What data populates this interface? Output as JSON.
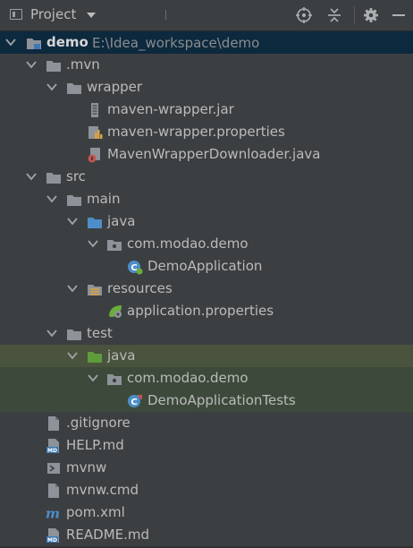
{
  "header": {
    "title": "Project"
  },
  "tree": {
    "root": {
      "name": "demo",
      "path": "E:\\Idea_workspace\\demo"
    },
    "mvn": ".mvn",
    "wrapper": "wrapper",
    "wrapper_jar": "maven-wrapper.jar",
    "wrapper_props": "maven-wrapper.properties",
    "wrapper_downloader": "MavenWrapperDownloader.java",
    "src": "src",
    "main": "main",
    "main_java": "java",
    "main_pkg": "com.modao.demo",
    "main_class": "DemoApplication",
    "resources": "resources",
    "app_props": "application.properties",
    "test": "test",
    "test_java": "java",
    "test_pkg": "com.modao.demo",
    "test_class": "DemoApplicationTests",
    "gitignore": ".gitignore",
    "help": "HELP.md",
    "mvnw": "mvnw",
    "mvnw_cmd": "mvnw.cmd",
    "pom": "pom.xml",
    "readme": "README.md"
  },
  "colors": {
    "folder": "#8d9399",
    "source_folder": "#4d8ec9",
    "test_folder": "#5e9c3b",
    "spring": "#6aad3d"
  }
}
